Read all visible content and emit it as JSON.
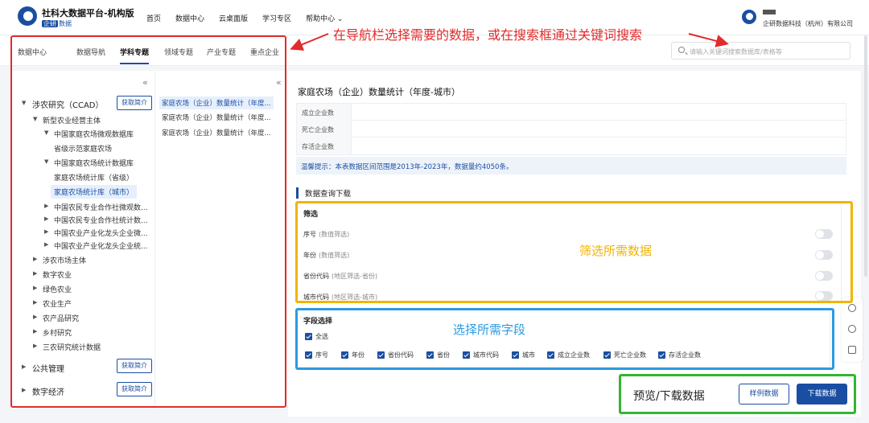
{
  "header": {
    "title": "社科大数据平台-机构版",
    "tag": "企研",
    "tag_suffix": "数据",
    "nav": [
      "首页",
      "数据中心",
      "云桌面版",
      "学习专区",
      "帮助中心 ⌄"
    ],
    "org": "企研数据科技（杭州）有限公司"
  },
  "tabs": {
    "items": [
      "数据中心",
      "数据导航",
      "学科专题",
      "领域专题",
      "产业专题",
      "重点企业"
    ],
    "active": "学科专题",
    "search_placeholder": "请输入关键词搜索数据库/表格等"
  },
  "tree": {
    "collapse_symbol": "«",
    "intro_label": "获取简介",
    "ccad": "涉农研究（CCAD）",
    "new_subject": "新型农业经营主体",
    "family_micro": "中国家庭农场微观数据库",
    "provincial_demo": "省级示范家庭农场",
    "family_stats": "中国家庭农场统计数据库",
    "stats_province": "家庭农场统计库（省级）",
    "stats_city": "家庭农场统计库（城市）",
    "coop_micro": "中国农民专业合作社微观数...",
    "coop_stats": "中国农民专业合作社统计数...",
    "industry_micro": "中国农业产业化龙头企业微...",
    "industry_stats": "中国农业产业化龙头企业统...",
    "market": "涉农市场主体",
    "digital_ag": "数字农业",
    "green_ag": "绿色农业",
    "ag_production": "农业生产",
    "ag_products": "农产品研究",
    "rural": "乡村研究",
    "sannong": "三农研究统计数据",
    "public_mgmt": "公共管理",
    "digital_econ": "数字经济"
  },
  "tables_list": {
    "items": [
      "家庭农场（企业）数量统计（年度...",
      "家庭农场（企业）数量统计（年度...",
      "家庭农场（企业）数量统计（年度..."
    ]
  },
  "main": {
    "title": "家庭农场（企业）数量统计（年度-城市）",
    "stats": [
      "成立企业数",
      "死亡企业数",
      "存活企业数"
    ],
    "tip": "温馨提示：本表数据区间范围是2013年-2023年，数据量约4050条。",
    "section_title": "数据查询下载",
    "filter_head": "筛选",
    "filters": [
      {
        "name": "序号",
        "hint": "(数值筛选)"
      },
      {
        "name": "年份",
        "hint": "(数值筛选)"
      },
      {
        "name": "省份代码",
        "hint": "(地区筛选-省份)"
      },
      {
        "name": "城市代码",
        "hint": "(地区筛选-城市)"
      }
    ],
    "field_head": "字段选择",
    "select_all": "全选",
    "fields": [
      "序号",
      "年份",
      "省份代码",
      "省份",
      "城市代码",
      "城市",
      "成立企业数",
      "死亡企业数",
      "存活企业数"
    ],
    "sample_button": "样例数据",
    "download_button": "下载数据"
  },
  "annotations": {
    "top": "在导航栏选择需要的数据，或在搜索框通过关键词搜索",
    "filter": "筛选所需数据",
    "fields": "选择所需字段",
    "download": "预览/下载数据",
    "colors": {
      "red": "#e22b2b",
      "yellow": "#f2b400",
      "blue": "#2b9be0",
      "green": "#33b533"
    }
  }
}
